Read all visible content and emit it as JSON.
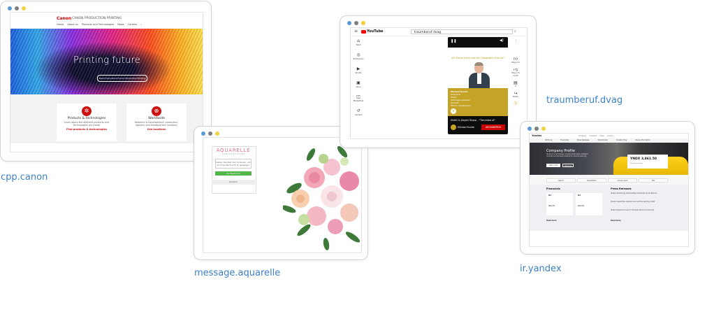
{
  "colors": {
    "dot_blue": "#5b9bd5",
    "dot_grey": "#7f7f7f",
    "dot_yellow": "#f4d03f",
    "caption": "#3d82c6",
    "canon_red": "#cc1111",
    "youtube_red": "#ff0000",
    "dvag_gold": "#c5a327",
    "aquarelle_pink": "#e06d95",
    "aquarelle_green": "#53b649"
  },
  "captions": {
    "canon": "cpp.canon",
    "aquarelle": "message.aquarelle",
    "dvag": "traumberuf.dvag",
    "yandex": "ir.yandex"
  },
  "canon": {
    "logo": "Canon",
    "brand": "CANON PRODUCTION PRINTING",
    "nav": [
      "Home",
      "About us",
      "Products and Technologies",
      "News",
      "Careers"
    ],
    "search_icon": "search-icon",
    "hero_title": "Printing future",
    "hero_button": "Read more about Canon Production Printing",
    "cards": [
      {
        "icon": "gear-icon",
        "title": "Products & technologies",
        "desc": "Learn about the different products and technologies we create",
        "link": "Find products & technologies"
      },
      {
        "icon": "globe-icon",
        "title": "Worldwide",
        "desc": "Research & Development, production, logistics and headquarters locations",
        "link": "See locations"
      }
    ]
  },
  "aquarelle": {
    "logo": "AQUARELLE",
    "subtitle": "A A R T D E S F L E U R S",
    "field_text": "Geben Sie hier den Code ein, um zu Ihrer Nachricht zu gelangen",
    "button": "Zur Nachricht",
    "bar": "Deutsch"
  },
  "youtube": {
    "logo_text": "YouTube",
    "search_value": "traumberuf dvag",
    "sidebar": [
      {
        "icon": "home-icon",
        "label": "Start"
      },
      {
        "icon": "explore-icon",
        "label": "Entdecken"
      },
      {
        "icon": "shorts-icon",
        "label": "Shorts"
      },
      {
        "icon": "subscriptions-icon",
        "label": "Abos"
      },
      {
        "icon": "library-icon",
        "label": "Mediathek"
      },
      {
        "icon": "history-icon",
        "label": "Verlauf"
      }
    ],
    "headline": "Ich freue mich auf ein Gespräch mit dir!",
    "person_lines": [
      "Michael Kunde",
      "Direktion",
      "DVAG",
      "Vermögensberater",
      "Kontakt",
      "Termin vereinbaren"
    ],
    "video_title": "DVAG & Jürgen Klopp - \"Traumberuf\"",
    "channel": "Michael Kunde",
    "subscribe": "ABONNIEREN",
    "actions": [
      {
        "icon": "thumbs-up-icon",
        "label": "Mag ich"
      },
      {
        "icon": "thumbs-down-icon",
        "label": "Mag ich nicht"
      },
      {
        "icon": "comment-icon",
        "label": "0"
      },
      {
        "icon": "share-icon",
        "label": "Teilen"
      }
    ]
  },
  "yandex": {
    "logo": "Yandex",
    "top_nav": [
      "Company",
      "Investors",
      "Press",
      "Careers"
    ],
    "tabs": [
      "IR Home",
      "Financials",
      "Press Releases",
      "Shareholder",
      "Investor Day",
      "Share Information"
    ],
    "hero_title": "Company Profile",
    "hero_text": "Yandex is a technology company that builds intelligent products and services powered by machine learning.",
    "hero_btn1": "Learn more",
    "hero_btn2": "About us",
    "ticker_name": "YNDX",
    "ticker_value": "3,861.50",
    "ticker_sub": "Moscow Exchange",
    "quick_links": [
      "Report",
      "Presentation",
      "Annual report",
      "FAQ"
    ],
    "financials_title": "Financials",
    "fin_cards": [
      {
        "q": "Q2",
        "label": "Results"
      },
      {
        "q": "Q1",
        "label": "Results"
      }
    ],
    "press_title": "Press Releases",
    "news": [
      {
        "date": "",
        "text": "Yandex Self-Driving Vehicles Begin Deliveries Across Moscow"
      },
      {
        "date": "",
        "text": "Yandex researchers develop new machine learning model"
      },
      {
        "date": "",
        "text": "Yandex Expands Access for the Open Source Community"
      }
    ],
    "read_more": "Read more"
  }
}
